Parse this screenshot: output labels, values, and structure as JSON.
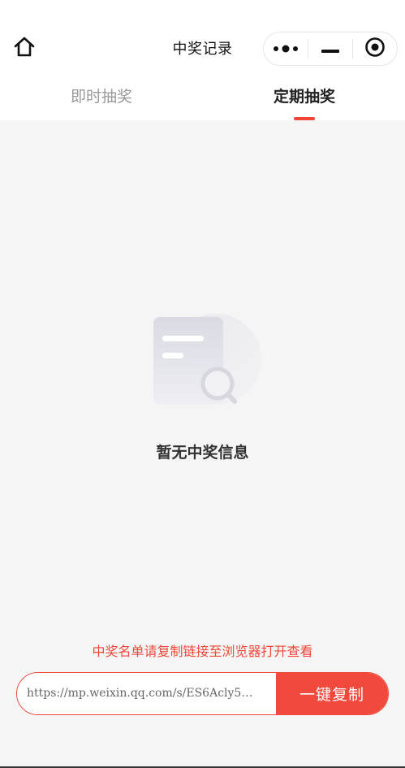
{
  "header": {
    "title": "中奖记录",
    "home_icon": "home-icon",
    "capsule": {
      "more_icon": "more-dots-icon",
      "minimize_icon": "minimize-icon",
      "close_icon": "target-close-icon"
    }
  },
  "tabs": [
    {
      "label": "即时抽奖",
      "active": false
    },
    {
      "label": "定期抽奖",
      "active": true
    }
  ],
  "empty_state": {
    "icon": "document-search-icon",
    "text": "暂无中奖信息"
  },
  "footer": {
    "notice": "中奖名单请复制链接至浏览器打开查看",
    "link_value": "https://mp.weixin.qq.com/s/ES6Acly5…",
    "copy_label": "一键复制"
  },
  "colors": {
    "accent": "#f04437",
    "background": "#f5f5f5"
  }
}
